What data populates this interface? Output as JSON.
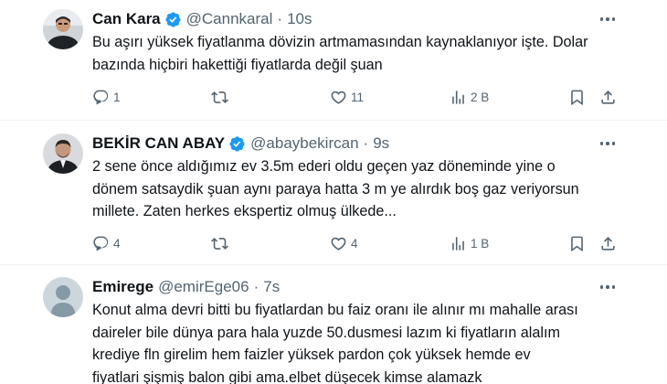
{
  "tweets": [
    {
      "name": "Can Kara",
      "handle": "@Cannkaral",
      "time": "10s",
      "verified": true,
      "lines": [
        "Bu aşırı yüksek fiyatlanma dövizin artmamasından kaynaklanıyor işte. Dolar",
        "bazında hiçbiri hakettiği fiyatlarda değil şuan"
      ],
      "replies": "1",
      "retweets": "",
      "likes": "11",
      "views": "2 B"
    },
    {
      "name": "BEKİR CAN ABAY",
      "handle": "@abaybekircan",
      "time": "9s",
      "verified": true,
      "lines": [
        "2 sene önce aldığımız ev 3.5m ederi oldu geçen yaz döneminde yine o",
        "dönem satsaydik şuan aynı paraya hatta 3 m ye alırdık boş gaz veriyorsun",
        "millete. Zaten herkes ekspertiz olmuş ülkede..."
      ],
      "replies": "4",
      "retweets": "",
      "likes": "4",
      "views": "1 B"
    },
    {
      "name": "Emirege",
      "handle": "@emirEge06",
      "time": "7s",
      "verified": false,
      "lines": [
        "Konut alma devri bitti bu fiyatlardan bu faiz oranı ile alınır mı mahalle arası",
        "daireler bile dünya para hala yuzde 50.dusmesi lazım ki fiyatların alalım",
        "krediye fln girelim hem faizler yüksek pardon çok yüksek hemde ev",
        "fiyatlari şişmiş balon gibi ama.elbet düşecek kimse alamazk"
      ]
    }
  ],
  "separator": "·",
  "icons": {
    "reply": "reply-icon",
    "retweet": "retweet-icon",
    "like": "heart-icon",
    "views": "views-icon",
    "bookmark": "bookmark-icon",
    "share": "share-icon",
    "more": "more-icon",
    "verified": "verified-badge-icon"
  },
  "colors": {
    "verified": "#1d9bf0",
    "text": "#0f1419",
    "secondary": "#536471",
    "divider": "#eff3f4"
  }
}
